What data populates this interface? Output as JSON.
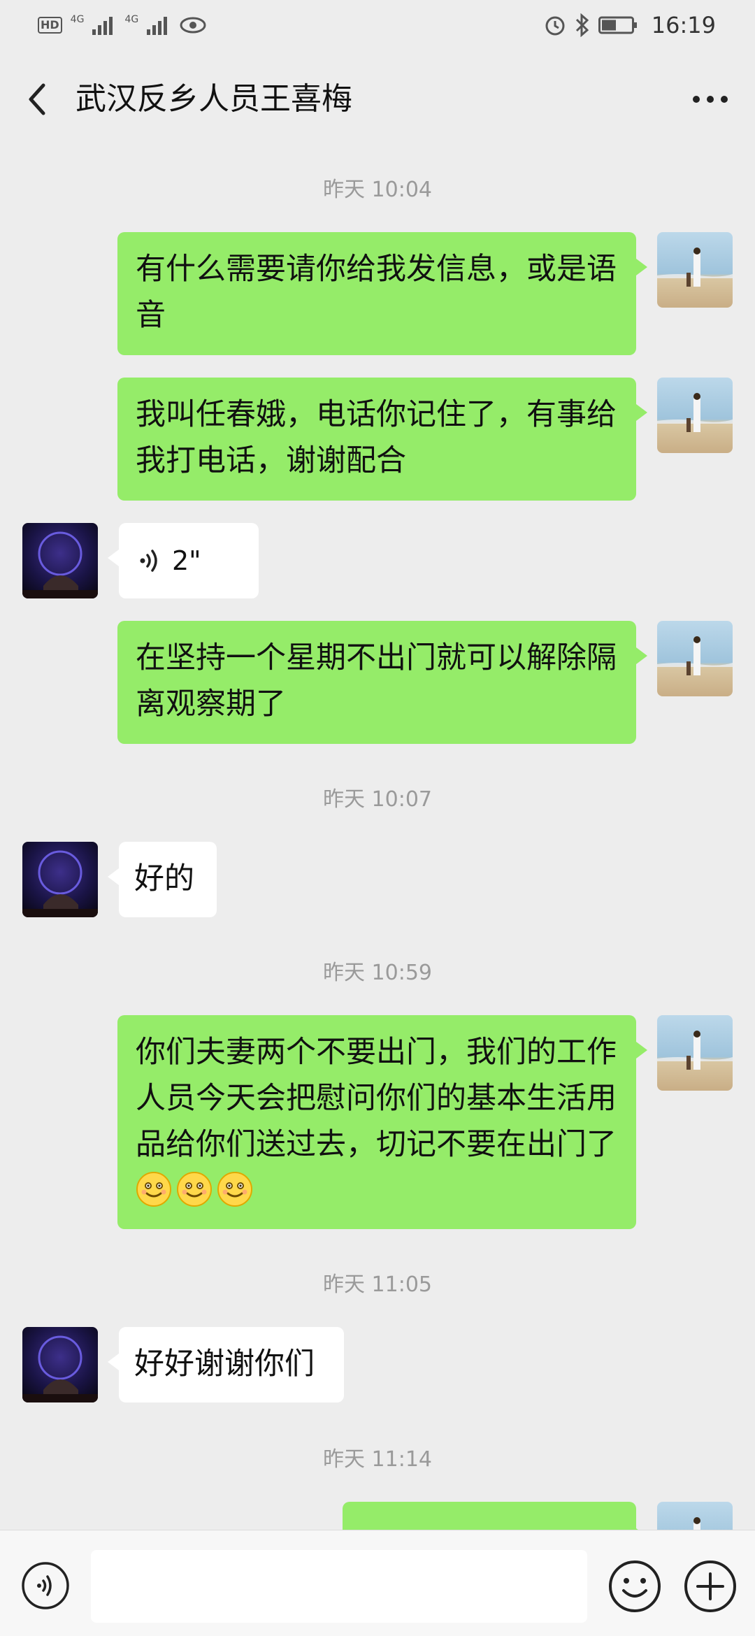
{
  "status_bar": {
    "hd": "HD",
    "net1": "4G",
    "net2": "4G",
    "time": "16:19",
    "icons": [
      "signal-icon",
      "eye-icon",
      "alarm-icon",
      "bluetooth-icon",
      "battery-icon"
    ]
  },
  "header": {
    "title": "武汉反乡人员王喜梅",
    "back_icon": "chevron-left-icon",
    "more_icon": "more-dots-icon"
  },
  "timestamps": {
    "t1": "昨天 10:04",
    "t2": "昨天 10:07",
    "t3": "昨天 10:59",
    "t4": "昨天 11:05",
    "t5": "昨天 11:14"
  },
  "messages": {
    "m1": "有什么需要请你给我发信息，或是语音",
    "m2": "我叫任春娥，电话你记住了，有事给我打电话，谢谢配合",
    "m3_voice_duration": "2\"",
    "m4": "在坚持一个星期不出门就可以解除隔离观察期了",
    "m5": "好的",
    "m6": "你们夫妻两个不要出门，我们的工作人员今天会把慰问你们的基本生活用品给你们送过去，切记不要在出门了",
    "m6_emojis": [
      "smile-emoji",
      "smile-emoji",
      "smile-emoji"
    ],
    "m7": "好好谢谢你们"
  },
  "input": {
    "placeholder": "",
    "value": ""
  },
  "colors": {
    "outgoing_bubble": "#95ec69",
    "incoming_bubble": "#ffffff",
    "background": "#ededed"
  }
}
